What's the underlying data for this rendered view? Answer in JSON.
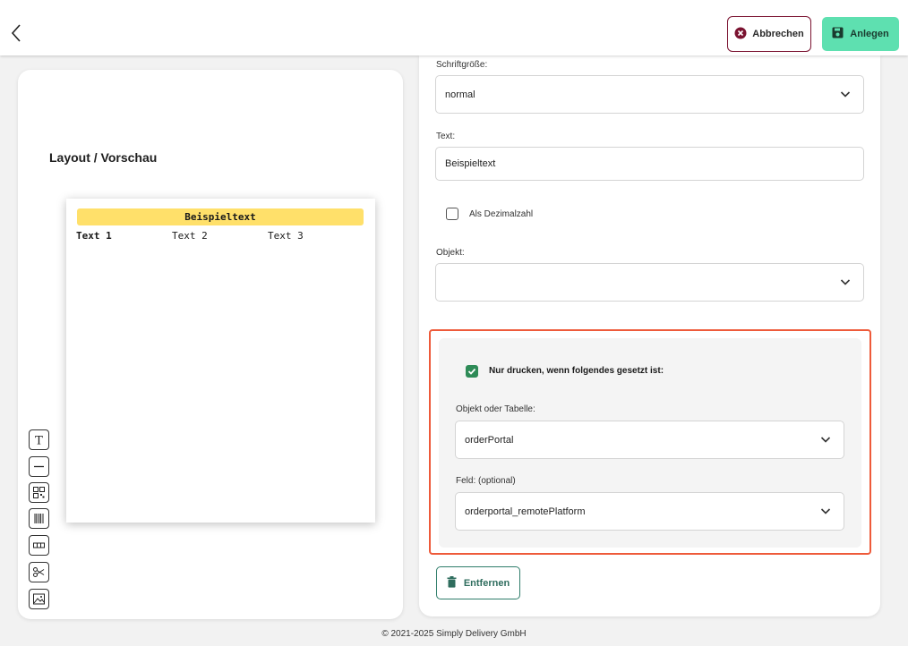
{
  "header": {
    "cancel_label": "Abbrechen",
    "create_label": "Anlegen"
  },
  "preview": {
    "title": "Layout / Vorschau",
    "paper": {
      "header_text": "Beispieltext",
      "columns": [
        "Text 1",
        "Text 2",
        "Text 3"
      ]
    },
    "tools": [
      "text-tool-icon",
      "line-tool-icon",
      "qr-code-tool-icon",
      "barcode-tool-icon",
      "table-tool-icon",
      "cut-tool-icon",
      "image-tool-icon"
    ]
  },
  "form": {
    "font_size_label": "Schriftgröße:",
    "font_size_value": "normal",
    "text_label": "Text:",
    "text_value": "Beispieltext",
    "decimal_label": "Als Dezimalzahl",
    "decimal_checked": false,
    "object_label": "Objekt:",
    "object_value": "",
    "condition": {
      "checkbox_label": "Nur drucken, wenn folgendes gesetzt ist:",
      "checked": true,
      "object_label": "Objekt oder Tabelle:",
      "object_value": "orderPortal",
      "field_label": "Feld: (optional)",
      "field_value": "orderportal_remotePlatform"
    },
    "remove_label": "Entfernen"
  },
  "footer": {
    "copyright": "© 2021-2025 Simply Delivery GmbH"
  },
  "colors": {
    "accent_green": "#5ee0b0",
    "cancel_border": "#7a1230",
    "highlight_border": "#ee5a3a",
    "checkbox_checked": "#2e8b57",
    "paper_header": "#ffe06a"
  }
}
